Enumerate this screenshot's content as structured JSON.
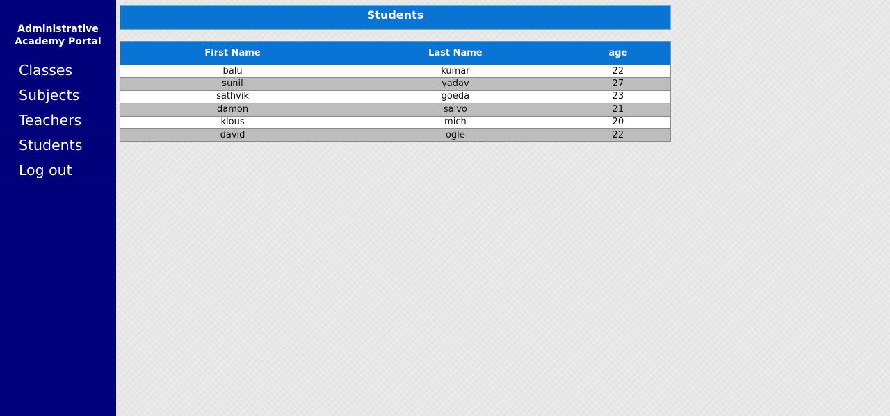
{
  "brand": {
    "line1": "Administrative",
    "line2": "Academy Portal"
  },
  "nav": [
    {
      "label": "Classes"
    },
    {
      "label": "Subjects"
    },
    {
      "label": "Teachers"
    },
    {
      "label": "Students"
    },
    {
      "label": "Log out"
    }
  ],
  "page": {
    "title": "Students"
  },
  "table": {
    "headers": [
      "First Name",
      "Last Name",
      "age"
    ],
    "rows": [
      [
        "balu",
        "kumar",
        "22"
      ],
      [
        "sunil",
        "yadav",
        "27"
      ],
      [
        "sathvik",
        "goeda",
        "23"
      ],
      [
        "damon",
        "salvo",
        "21"
      ],
      [
        "klous",
        "mich",
        "20"
      ],
      [
        "david",
        "ogle",
        "22"
      ]
    ]
  },
  "colors": {
    "sidebar": "#00007a",
    "header": "#0a74d4",
    "row_alt": "#bdbdbd",
    "background": "#e8e8e8"
  }
}
